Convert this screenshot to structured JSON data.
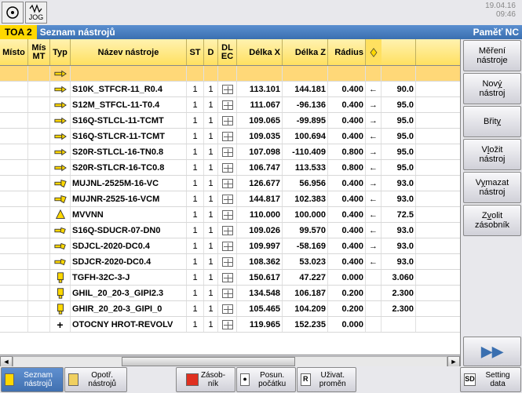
{
  "datetime": {
    "date": "19.04.16",
    "time": "09:46"
  },
  "top_icons": {
    "jog": "JOG"
  },
  "header": {
    "toa": "TOA 2",
    "title": "Seznam nástrojů",
    "right": "Paměť NC"
  },
  "columns": {
    "misto": "Místo",
    "mismt": "Mís\nMT",
    "typ": "Typ",
    "name": "Název nástroje",
    "st": "ST",
    "d": "D",
    "dlec": "DL\nEC",
    "dx": "Délka X",
    "dz": "Délka Z",
    "radius": "Rádius"
  },
  "rows": [
    {
      "name": "",
      "st": "",
      "d": "",
      "dx": "",
      "dz": "",
      "rad": "",
      "arr": "",
      "val": "",
      "icon": "diamond"
    },
    {
      "name": "S10K_STFCR-11_R0.4",
      "st": "1",
      "d": "1",
      "dx": "113.101",
      "dz": "144.181",
      "rad": "0.400",
      "arr": "←",
      "val": "90.0",
      "icon": "diamond"
    },
    {
      "name": "S12M_STFCL-11-T0.4",
      "st": "1",
      "d": "1",
      "dx": "111.067",
      "dz": "-96.136",
      "rad": "0.400",
      "arr": "→",
      "val": "95.0",
      "icon": "diamond"
    },
    {
      "name": "S16Q-STLCL-11-TCMT",
      "st": "1",
      "d": "1",
      "dx": "109.065",
      "dz": "-99.895",
      "rad": "0.400",
      "arr": "→",
      "val": "95.0",
      "icon": "diamond"
    },
    {
      "name": "S16Q-STLCR-11-TCMT",
      "st": "1",
      "d": "1",
      "dx": "109.035",
      "dz": "100.694",
      "rad": "0.400",
      "arr": "←",
      "val": "95.0",
      "icon": "diamond"
    },
    {
      "name": "S20R-STLCL-16-TN0.8",
      "st": "1",
      "d": "1",
      "dx": "107.098",
      "dz": "-110.409",
      "rad": "0.800",
      "arr": "→",
      "val": "95.0",
      "icon": "diamond"
    },
    {
      "name": "S20R-STLCR-16-TC0.8",
      "st": "1",
      "d": "1",
      "dx": "106.747",
      "dz": "113.533",
      "rad": "0.800",
      "arr": "←",
      "val": "95.0",
      "icon": "diamond"
    },
    {
      "name": "MUJNL-2525M-16-VC",
      "st": "1",
      "d": "1",
      "dx": "126.677",
      "dz": "56.956",
      "rad": "0.400",
      "arr": "→",
      "val": "93.0",
      "icon": "rhomb"
    },
    {
      "name": "MUJNR-2525-16-VCM",
      "st": "1",
      "d": "1",
      "dx": "144.817",
      "dz": "102.383",
      "rad": "0.400",
      "arr": "←",
      "val": "93.0",
      "icon": "rhomb"
    },
    {
      "name": "MVVNN",
      "st": "1",
      "d": "1",
      "dx": "110.000",
      "dz": "100.000",
      "rad": "0.400",
      "arr": "←",
      "val": "72.5",
      "icon": "tri"
    },
    {
      "name": "S16Q-SDUCR-07-DN0",
      "st": "1",
      "d": "1",
      "dx": "109.026",
      "dz": "99.570",
      "rad": "0.400",
      "arr": "←",
      "val": "93.0",
      "icon": "rhomb2"
    },
    {
      "name": "SDJCL-2020-DC0.4",
      "st": "1",
      "d": "1",
      "dx": "109.997",
      "dz": "-58.169",
      "rad": "0.400",
      "arr": "→",
      "val": "93.0",
      "icon": "rhomb2"
    },
    {
      "name": "SDJCR-2020-DC0.4",
      "st": "1",
      "d": "1",
      "dx": "108.362",
      "dz": "53.023",
      "rad": "0.400",
      "arr": "←",
      "val": "93.0",
      "icon": "rhomb2"
    },
    {
      "name": "TGFH-32C-3-J",
      "st": "1",
      "d": "1",
      "dx": "150.617",
      "dz": "47.227",
      "rad": "0.000",
      "arr": "",
      "val": "3.060",
      "icon": "groove"
    },
    {
      "name": "GHIL_20_20-3_GIPI2.3",
      "st": "1",
      "d": "1",
      "dx": "134.548",
      "dz": "106.187",
      "rad": "0.200",
      "arr": "",
      "val": "2.300",
      "icon": "groove"
    },
    {
      "name": "GHIR_20_20-3_GIPI_0",
      "st": "1",
      "d": "1",
      "dx": "105.465",
      "dz": "104.209",
      "rad": "0.200",
      "arr": "",
      "val": "2.300",
      "icon": "groove"
    },
    {
      "name": "OTOCNY HROT-REVOLV",
      "st": "1",
      "d": "1",
      "dx": "119.965",
      "dz": "152.235",
      "rad": "0.000",
      "arr": "",
      "val": "",
      "icon": "plus"
    }
  ],
  "side": {
    "measure": "Měření nástroje",
    "new": "Nový nástroj",
    "edges": "Břity",
    "insert": "Vložit nástroj",
    "delete": "Vymazat nástroj",
    "select": "Zvolit zásobník"
  },
  "bottom": {
    "list": "Seznam nástrojů",
    "wear": "Opotř. nástrojů",
    "magazine": "Zásob-\nník",
    "offset": "Posun. počátku",
    "uservar": "Uživat. proměn",
    "setting": "Setting data",
    "r": "R",
    "sd": "SD",
    "clock": "●"
  }
}
